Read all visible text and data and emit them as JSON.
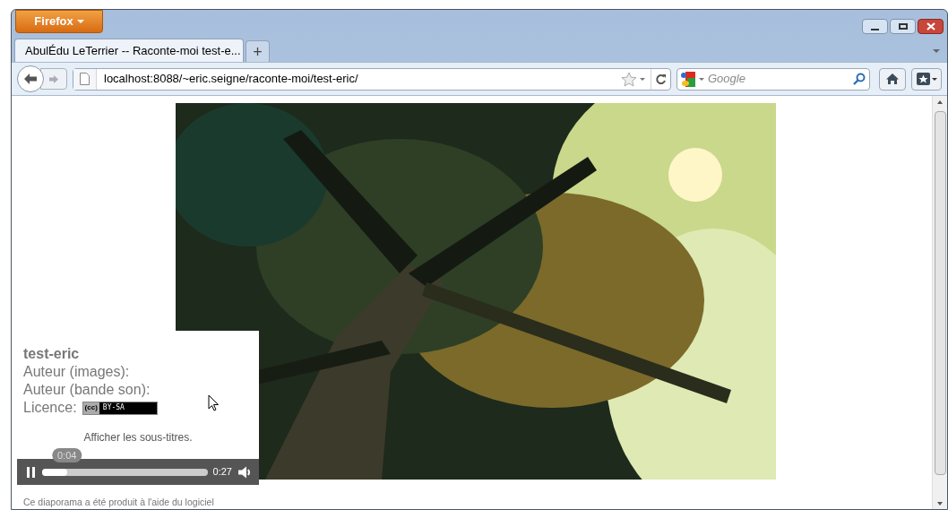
{
  "app_button": {
    "label": "Firefox"
  },
  "tabs": [
    {
      "label": "AbulÉdu LeTerrier -- Raconte-moi test-e...",
      "selected": true
    }
  ],
  "new_tab": {
    "label": "+"
  },
  "address_bar": {
    "value": "localhost:8088/~eric.seigne/raconte-moi/test-eric/"
  },
  "search": {
    "placeholder": "Google"
  },
  "page": {
    "title": "test-eric",
    "fields": [
      "Auteur (images):",
      "Auteur (bande son):"
    ],
    "licence_label": "Licence:",
    "licence_badge": {
      "cc": "(cc)",
      "terms": "BY-SA"
    },
    "subtitles_link": "Afficher les sous-titres.",
    "player": {
      "playing": true,
      "current": "0:04",
      "duration": "0:27",
      "level": 0.15
    },
    "footer": "Ce diaporama a été produit à l'aide du logiciel"
  }
}
